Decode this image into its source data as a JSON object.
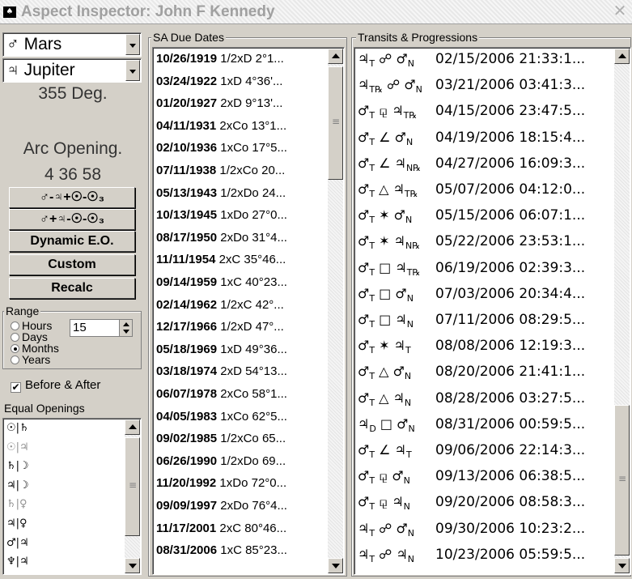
{
  "window": {
    "title": "Aspect Inspector: John F Kennedy",
    "close": "✕"
  },
  "left": {
    "planet1": "♂ Mars",
    "planet2": "♃ Jupiter",
    "degree": "355 Deg.",
    "arc_label": "Arc Opening.",
    "arc_value": "4 36 58",
    "buttons": [
      "♂-♃+☉-☉₃",
      "♂+♃-☉-☉₃",
      "Dynamic E.O.",
      "Custom",
      "Recalc"
    ],
    "range": {
      "label": "Range",
      "value": "15",
      "options": [
        "Hours",
        "Days",
        "Months",
        "Years"
      ],
      "selected": "Months"
    },
    "before_after": "Before & After",
    "equal_label": "Equal Openings",
    "equal_items": [
      "☉|♄",
      "☉|♃",
      "♄|☽",
      "♃|☽",
      "♄|♀",
      "♃|♀",
      "♂|♃",
      "♆|♃"
    ]
  },
  "sa": {
    "label": "SA Due Dates",
    "rows": [
      {
        "date": "10/26/1919",
        "rest": " 1/2xD 2°1..."
      },
      {
        "date": "03/24/1922",
        "rest": " 1xD 4°36'..."
      },
      {
        "date": "01/20/1927",
        "rest": " 2xD 9°13'..."
      },
      {
        "date": "04/11/1931",
        "rest": " 2xCo 13°1..."
      },
      {
        "date": "02/10/1936",
        "rest": " 1xCo 17°5..."
      },
      {
        "date": "07/11/1938",
        "rest": " 1/2xCo 20..."
      },
      {
        "date": "05/13/1943",
        "rest": " 1/2xDo 24..."
      },
      {
        "date": "10/13/1945",
        "rest": " 1xDo 27°0..."
      },
      {
        "date": "08/17/1950",
        "rest": " 2xDo 31°4..."
      },
      {
        "date": "11/11/1954",
        "rest": " 2xC 35°46..."
      },
      {
        "date": "09/14/1959",
        "rest": " 1xC 40°23..."
      },
      {
        "date": "02/14/1962",
        "rest": " 1/2xC 42°..."
      },
      {
        "date": "12/17/1966",
        "rest": " 1/2xD 47°..."
      },
      {
        "date": "05/18/1969",
        "rest": " 1xD 49°36..."
      },
      {
        "date": "03/18/1974",
        "rest": " 2xD 54°13..."
      },
      {
        "date": "06/07/1978",
        "rest": " 2xCo 58°1..."
      },
      {
        "date": "04/05/1983",
        "rest": " 1xCo 62°5..."
      },
      {
        "date": "09/02/1985",
        "rest": " 1/2xCo 65..."
      },
      {
        "date": "06/26/1990",
        "rest": " 1/2xDo 69..."
      },
      {
        "date": "11/20/1992",
        "rest": " 1xDo 72°0..."
      },
      {
        "date": "09/09/1997",
        "rest": " 2xDo 76°4..."
      },
      {
        "date": "11/17/2001",
        "rest": " 2xC 80°46..."
      },
      {
        "date": "08/31/2006",
        "rest": " 1xC 85°23..."
      }
    ]
  },
  "tr": {
    "label": "Transits & Progressions",
    "rows": [
      {
        "a": "♃",
        "as": "T",
        "asp": "☍",
        "b": "♂",
        "bs": "N",
        "dt": "02/15/2006 21:33:1..."
      },
      {
        "a": "♃",
        "as": "T℞",
        "asp": "☍",
        "b": "♂",
        "bs": "N",
        "dt": "03/21/2006 03:41:3..."
      },
      {
        "a": "♂",
        "as": "T",
        "asp": "⚼",
        "b": "♃",
        "bs": "T℞",
        "dt": "04/15/2006 23:47:5..."
      },
      {
        "a": "♂",
        "as": "T",
        "asp": "∠",
        "b": "♂",
        "bs": "N",
        "dt": "04/19/2006 18:15:4..."
      },
      {
        "a": "♂",
        "as": "T",
        "asp": "∠",
        "b": "♃",
        "bs": "N℞",
        "dt": "04/27/2006 16:09:3..."
      },
      {
        "a": "♂",
        "as": "T",
        "asp": "△",
        "b": "♃",
        "bs": "T℞",
        "dt": "05/07/2006 04:12:0..."
      },
      {
        "a": "♂",
        "as": "T",
        "asp": "✶",
        "b": "♂",
        "bs": "N",
        "dt": "05/15/2006 06:07:1..."
      },
      {
        "a": "♂",
        "as": "T",
        "asp": "✶",
        "b": "♃",
        "bs": "N℞",
        "dt": "05/22/2006 23:53:1..."
      },
      {
        "a": "♂",
        "as": "T",
        "asp": "□",
        "b": "♃",
        "bs": "T℞",
        "dt": "06/19/2006 02:39:3..."
      },
      {
        "a": "♂",
        "as": "T",
        "asp": "□",
        "b": "♂",
        "bs": "N",
        "dt": "07/03/2006 20:34:4..."
      },
      {
        "a": "♂",
        "as": "T",
        "asp": "□",
        "b": "♃",
        "bs": "N",
        "dt": "07/11/2006 08:29:5..."
      },
      {
        "a": "♂",
        "as": "T",
        "asp": "✶",
        "b": "♃",
        "bs": "T",
        "dt": "08/08/2006 12:19:3..."
      },
      {
        "a": "♂",
        "as": "T",
        "asp": "△",
        "b": "♂",
        "bs": "N",
        "dt": "08/20/2006 21:41:1..."
      },
      {
        "a": "♂",
        "as": "T",
        "asp": "△",
        "b": "♃",
        "bs": "N",
        "dt": "08/28/2006 03:27:5..."
      },
      {
        "a": "♃",
        "as": "D",
        "asp": "□",
        "b": "♂",
        "bs": "N",
        "dt": "08/31/2006 00:59:5..."
      },
      {
        "a": "♂",
        "as": "T",
        "asp": "∠",
        "b": "♃",
        "bs": "T",
        "dt": "09/06/2006 22:14:3..."
      },
      {
        "a": "♂",
        "as": "T",
        "asp": "⚼",
        "b": "♂",
        "bs": "N",
        "dt": "09/13/2006 06:38:5..."
      },
      {
        "a": "♂",
        "as": "T",
        "asp": "⚼",
        "b": "♃",
        "bs": "N",
        "dt": "09/20/2006 08:58:3..."
      },
      {
        "a": "♃",
        "as": "T",
        "asp": "☍",
        "b": "♂",
        "bs": "N",
        "dt": "09/30/2006 10:23:2..."
      },
      {
        "a": "♃",
        "as": "T",
        "asp": "☍",
        "b": "♃",
        "bs": "N",
        "dt": "10/23/2006 05:59:5..."
      }
    ]
  }
}
